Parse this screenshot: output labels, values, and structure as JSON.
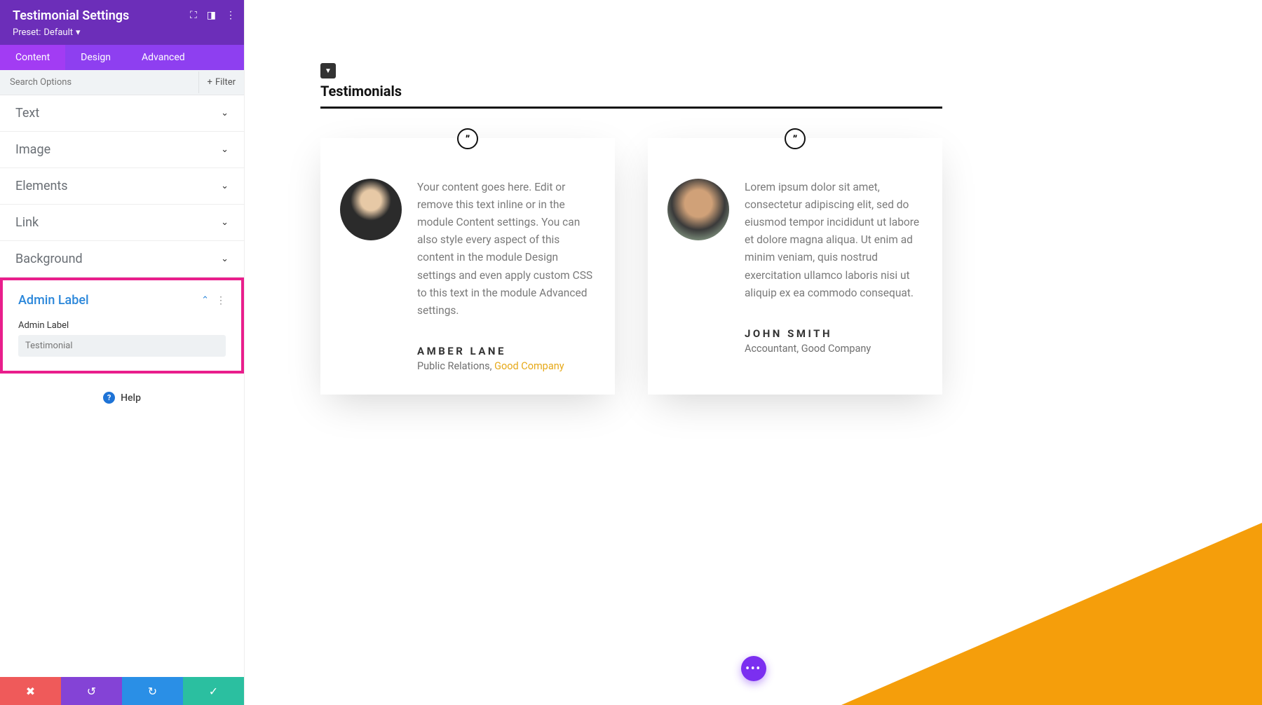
{
  "sidebar": {
    "title": "Testimonial Settings",
    "preset_label": "Preset:",
    "preset_value": "Default",
    "tabs": [
      "Content",
      "Design",
      "Advanced"
    ],
    "active_tab": 0,
    "search_placeholder": "Search Options",
    "filter_label": "Filter",
    "sections": [
      "Text",
      "Image",
      "Elements",
      "Link",
      "Background"
    ],
    "admin_section": {
      "title": "Admin Label",
      "field_label": "Admin Label",
      "field_value": "Testimonial"
    },
    "help_label": "Help"
  },
  "preview": {
    "section_title": "Testimonials",
    "cards": [
      {
        "text": "Your content goes here. Edit or remove this text inline or in the module Content settings. You can also style every aspect of this content in the module Design settings and even apply custom CSS to this text in the module Advanced settings.",
        "name": "AMBER LANE",
        "role": "Public Relations,",
        "company": "Good Company",
        "company_linked": true
      },
      {
        "text": "Lorem ipsum dolor sit amet, consectetur adipiscing elit, sed do eiusmod tempor incididunt ut labore et dolore magna aliqua. Ut enim ad minim veniam, quis nostrud exercitation ullamco laboris nisi ut aliquip ex ea commodo consequat.",
        "name": "JOHN SMITH",
        "role": "Accountant,",
        "company": "Good Company",
        "company_linked": false
      }
    ]
  }
}
